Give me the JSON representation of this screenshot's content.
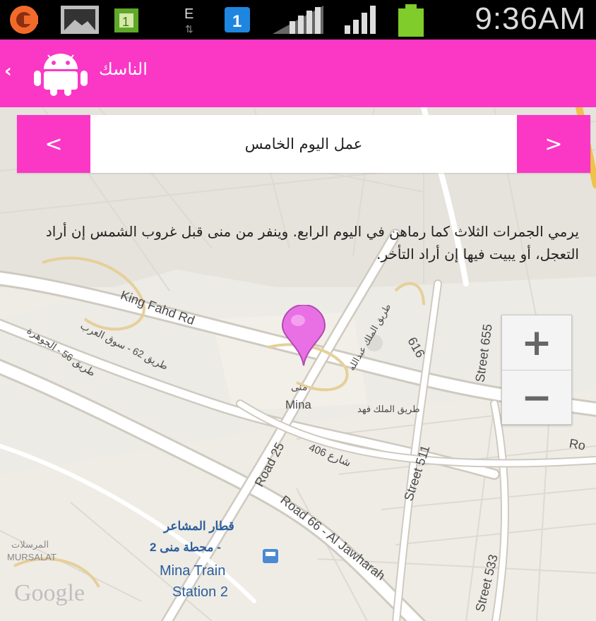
{
  "status_bar": {
    "time": "9:36AM",
    "icons": [
      "app-notification-icon",
      "gallery-icon",
      "sim-card-icon",
      "edge-data-icon",
      "signal-one-icon",
      "wifi-signal-icon",
      "cell-signal-icon",
      "battery-icon"
    ]
  },
  "action_bar": {
    "title": "الناسك",
    "back_glyph": "‹",
    "logo": "android-icon"
  },
  "day_nav": {
    "prev_glyph": "<",
    "title": "عمل اليوم الخامس",
    "next_glyph": ">"
  },
  "description": "يرمي الجمرات الثلاث كما رماهن في اليوم الرابع. وينفر من منى قبل غروب الشمس إن أراد التعجل، أو يبيت فيها إن أراد التأخر.",
  "map": {
    "labels": {
      "king_fahd": "King Fahd Rd",
      "road_62": "طريق 62 - سوق العرب",
      "road_56": "طريق 56 - الجوهرة",
      "mina_ar": "منى",
      "mina_en": "Mina",
      "road_25": "Road 25",
      "road_406": "شارع 406",
      "street_511": "Street 511",
      "road_66": "Road 66 - Al Jawharah",
      "street_533": "Street 533",
      "street_655": "Street 655",
      "road_616": "616",
      "ro": "Ro",
      "station_ar1": "قطار المشاعر",
      "station_ar2": "محطة منى 2 -",
      "station_en1": "Mina Train",
      "station_en2": "Station 2",
      "mursalat_ar": "المرسلات",
      "mursalat_en": "MURSALAT",
      "google": "Google",
      "arabic_road_right": "طريق الملك فهد",
      "arabic_road_diag": "طريق الملك عبدالله"
    },
    "marker_color": "#e970e4"
  },
  "zoom": {
    "in_label": "+",
    "out_label": "−"
  },
  "colors": {
    "accent": "#fb37c6",
    "status_bg": "#000000"
  }
}
